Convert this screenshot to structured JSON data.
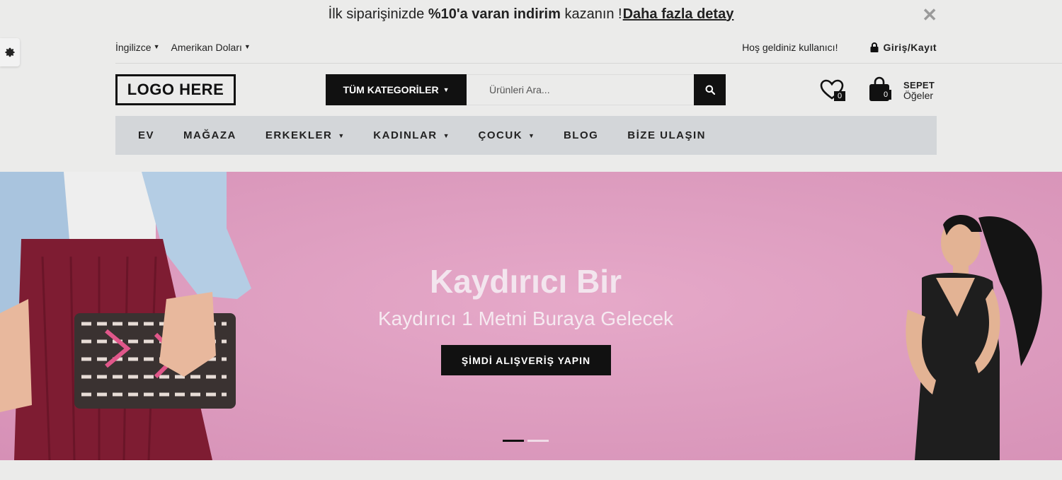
{
  "announcement": {
    "text_before": "İlk siparişinizde ",
    "text_bold": "%10'a varan indirim",
    "text_after": " kazanın !",
    "link": "Daha fazla detay",
    "close_icon": "close-icon"
  },
  "topbar": {
    "language": "İngilizce",
    "currency": "Amerikan Doları",
    "welcome": "Hoş geldiniz kullanıcı!",
    "login": "Giriş/Kayıt"
  },
  "header": {
    "logo": "LOGO HERE",
    "category_button": "TÜM KATEGORİLER",
    "search_placeholder": "Ürünleri Ara...",
    "wishlist_count": "0",
    "cart_count": "0",
    "cart_title": "SEPET",
    "cart_sub": "Öğeler"
  },
  "nav": {
    "items": [
      {
        "label": "EV",
        "dropdown": false
      },
      {
        "label": "MAĞAZA",
        "dropdown": false
      },
      {
        "label": "ERKEKLER",
        "dropdown": true
      },
      {
        "label": "KADINLAR",
        "dropdown": true
      },
      {
        "label": "ÇOCUK",
        "dropdown": true
      },
      {
        "label": "BLOG",
        "dropdown": false
      },
      {
        "label": "BİZE ULAŞIN",
        "dropdown": false
      }
    ]
  },
  "hero": {
    "title": "Kaydırıcı Bir",
    "subtitle": "Kaydırıcı 1 Metni Buraya Gelecek",
    "button": "ŞİMDİ ALIŞVERİŞ YAPIN",
    "active_slide": 1,
    "slide_count": 2
  },
  "colors": {
    "accent": "#111111",
    "hero_bg": "#de9ec0",
    "nav_bg": "#d3d6d9",
    "page_bg": "#ebebea"
  }
}
